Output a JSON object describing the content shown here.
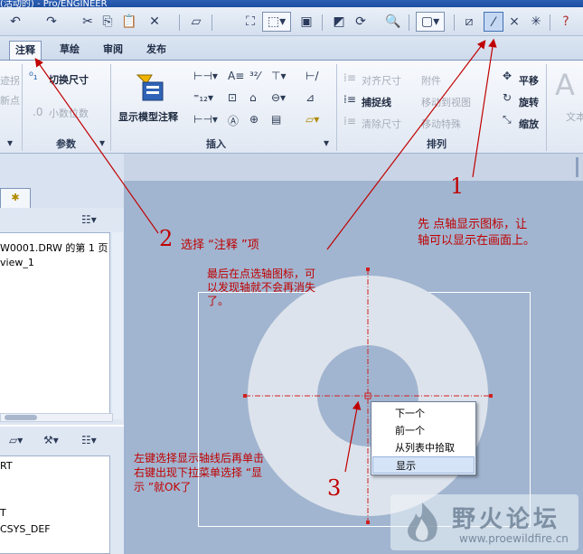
{
  "window": {
    "title": "(活动的) - Pro/ENGINEER"
  },
  "quick_toolbar": {
    "icons": [
      "undo-icon",
      "redo-icon",
      "cut-icon",
      "copy-icon",
      "paste-icon",
      "delete-icon",
      "layer-icon",
      "find-icon",
      "select-box-icon",
      "repaint-icon",
      "redraw-icon",
      "refit-icon",
      "zoom-icon",
      "display-style-icon",
      "plane-display-icon",
      "axis-display-icon",
      "point-display-icon",
      "csys-display-icon",
      "help-icon"
    ]
  },
  "tabs": [
    {
      "label": "注释",
      "active": true
    },
    {
      "label": "草绘"
    },
    {
      "label": "审阅"
    },
    {
      "label": "发布"
    }
  ],
  "ribbon": {
    "left_partial_1": "迹拐",
    "left_partial_2": "新点",
    "toggle_dim": "切换尺寸",
    "decimal_places": "小数位数",
    "group_params": "参数",
    "show_model_annotations": "显示模型注释",
    "group_insert": "插入",
    "align_dims": "对齐尺寸",
    "attachment": "附件",
    "capture_line": "捕捉线",
    "move_to_view": "移动到视图",
    "clear_dims": "清除尺寸",
    "move_special": "移动特殊",
    "pan": "平移",
    "rotate": "旋转",
    "scale": "缩放",
    "text": "文本",
    "group_arrange": "排列"
  },
  "model_tree": {
    "items": [
      "W0001.DRW 的第 1 页",
      "view_1"
    ]
  },
  "layer_tree": {
    "items": [
      "RT",
      "T",
      "CSYS_DEF"
    ]
  },
  "context_menu": {
    "items": [
      "下一个",
      "前一个",
      "从列表中拾取",
      "显示"
    ],
    "selected_index": 3
  },
  "annotations": {
    "num_1": "1",
    "note_1": "先 点轴显示图标，让\n轴可以显示在画面上。",
    "num_2": "2",
    "note_2": "选择 “注释 ”项",
    "note_final": "最后在点选轴图标，可\n以发现轴就不会再消失\n了。",
    "num_3": "3",
    "note_3": "左键选择显示轴线后再单击\n右键出现下拉菜单选择 “显\n示 ”就OK了",
    "color": "#c00000"
  },
  "watermark": {
    "site_name": "野火论坛",
    "url": "www.proewildfire.cn"
  },
  "colors": {
    "canvas": "#a1b5d0",
    "annulus": "#dde3ec",
    "axis_line": "#d02020"
  }
}
